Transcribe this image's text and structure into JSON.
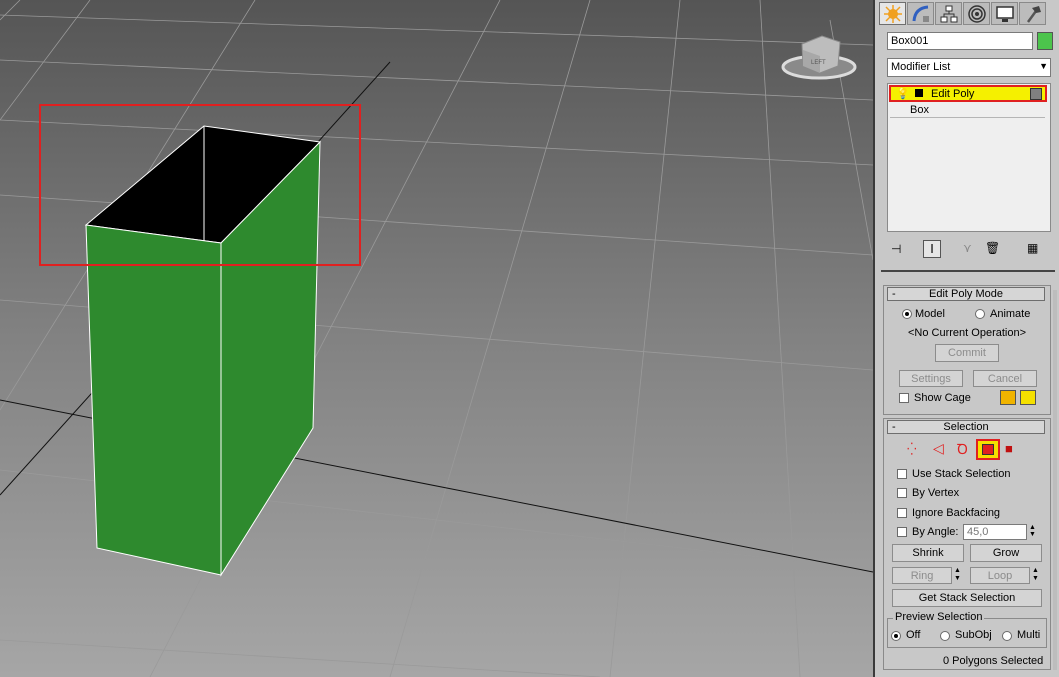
{
  "viewcube": {
    "face_label": "LEFT"
  },
  "command_panel": {
    "tabs": [
      "create-tab",
      "modify-tab",
      "hierarchy-tab",
      "motion-tab",
      "display-tab",
      "utilities-tab"
    ],
    "object_name": "Box001",
    "object_color": "#4cc44c",
    "modifier_list_label": "Modifier List",
    "stack": {
      "active_modifier": "Edit Poly",
      "base_object": "Box"
    },
    "edit_poly_mode": {
      "title": "Edit Poly Mode",
      "model_label": "Model",
      "animate_label": "Animate",
      "operation_status": "<No Current Operation>",
      "commit_label": "Commit",
      "settings_label": "Settings",
      "cancel_label": "Cancel",
      "show_cage_label": "Show Cage",
      "cage_colors": [
        "#f0b400",
        "#f5e000"
      ]
    },
    "selection": {
      "title": "Selection",
      "use_stack_label": "Use Stack Selection",
      "by_vertex_label": "By Vertex",
      "ignore_backfacing_label": "Ignore Backfacing",
      "by_angle_label": "By Angle:",
      "by_angle_value": "45,0",
      "shrink_label": "Shrink",
      "grow_label": "Grow",
      "ring_label": "Ring",
      "loop_label": "Loop",
      "get_stack_label": "Get Stack Selection",
      "preview_title": "Preview Selection",
      "preview_off": "Off",
      "preview_subobj": "SubObj",
      "preview_multi": "Multi",
      "status": "0 Polygons Selected"
    }
  },
  "colors": {
    "accent_highlight": "#e02020",
    "box_green": "#2e8a2e",
    "stack_active": "#f5f000"
  }
}
